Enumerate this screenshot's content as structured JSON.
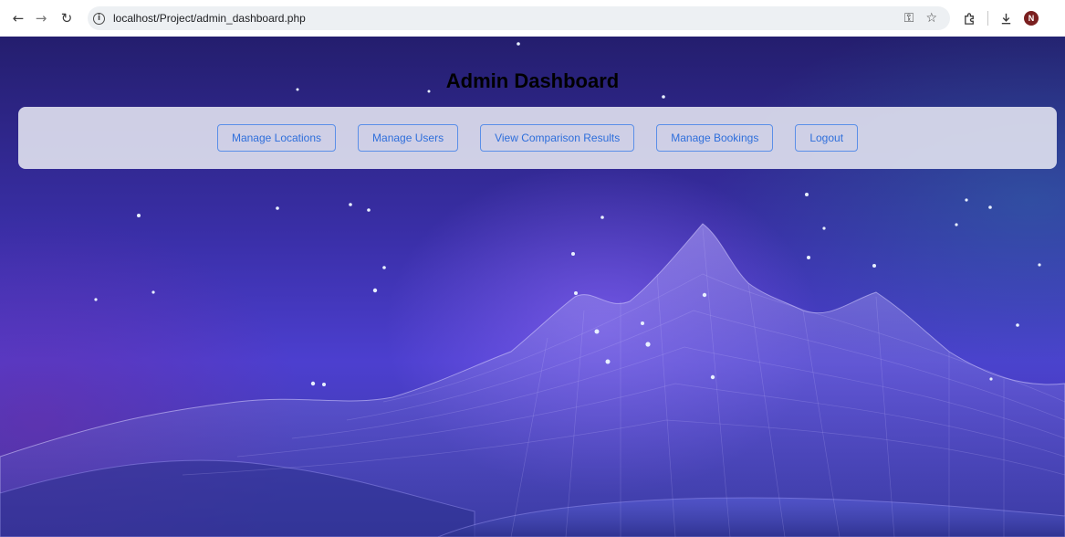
{
  "browser": {
    "url": "localhost/Project/admin_dashboard.php",
    "avatar_initial": "N",
    "icons": [
      "back-arrow-icon",
      "forward-arrow-icon",
      "reload-icon",
      "site-info-icon",
      "password-key-icon",
      "bookmark-star-icon",
      "extensions-icon",
      "download-icon"
    ]
  },
  "page": {
    "title": "Admin Dashboard",
    "nav": [
      {
        "label": "Manage Locations"
      },
      {
        "label": "Manage Users"
      },
      {
        "label": "View Comparison Results"
      },
      {
        "label": "Manage Bookings"
      },
      {
        "label": "Logout"
      }
    ]
  },
  "colors": {
    "button_border": "#5b8fe8",
    "button_text": "#2f6fdb",
    "panel_bg": "#e1e2f0",
    "title": "#000000",
    "background_top": "#241e6e",
    "background_mid": "#4c3fcf"
  }
}
